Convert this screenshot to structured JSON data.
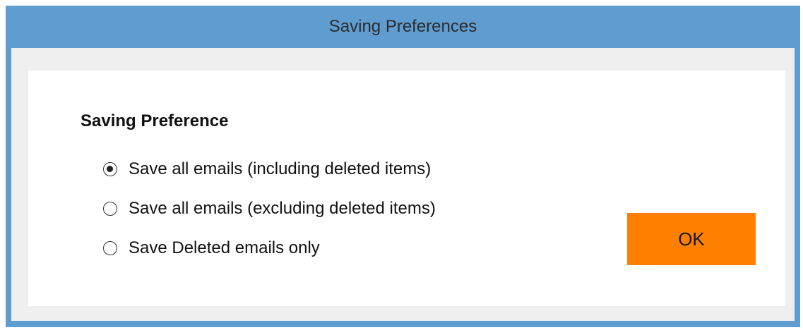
{
  "window": {
    "title": "Saving Preferences"
  },
  "section": {
    "label": "Saving Preference"
  },
  "options": [
    {
      "label": "Save all emails (including deleted items)",
      "selected": true
    },
    {
      "label": "Save all emails (excluding deleted items)",
      "selected": false
    },
    {
      "label": "Save Deleted emails only",
      "selected": false
    }
  ],
  "buttons": {
    "ok_label": "OK"
  },
  "colors": {
    "titlebar": "#5f9dd1",
    "client_bg": "#efefef",
    "panel_bg": "#ffffff",
    "ok_button": "#ff8000"
  }
}
